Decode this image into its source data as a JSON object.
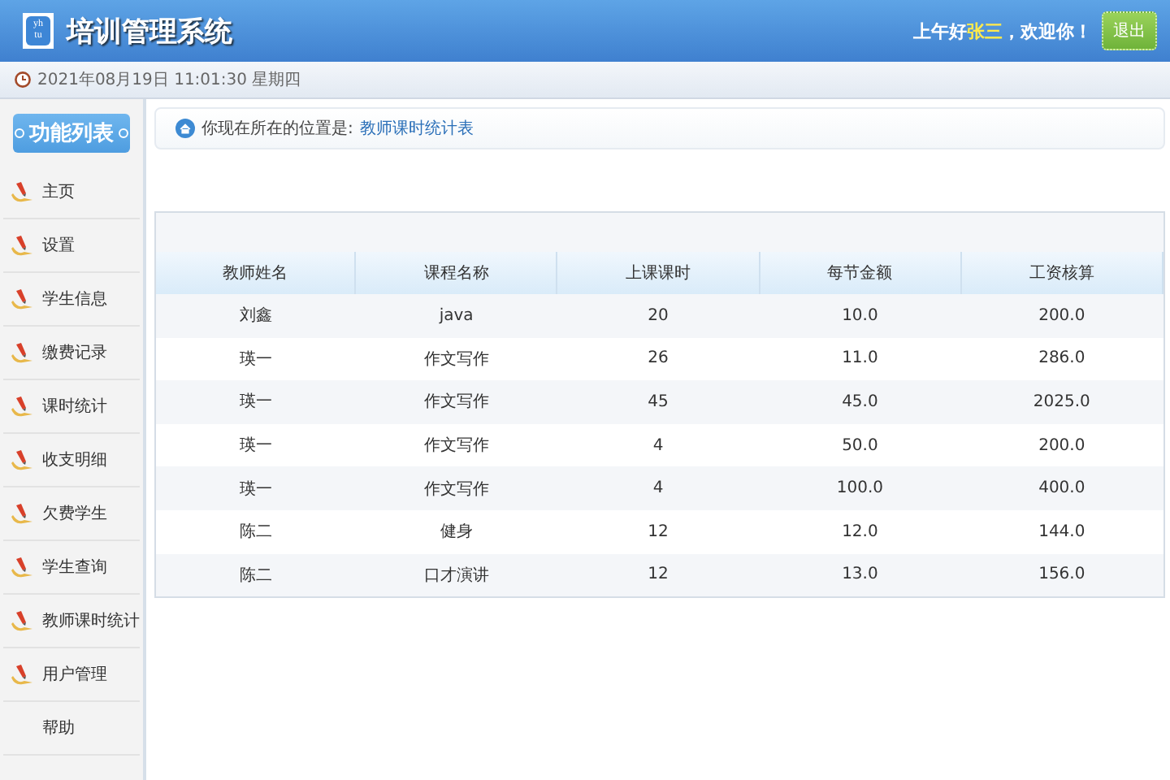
{
  "header": {
    "logo_text": "yh\ntu",
    "title": "培训管理系统",
    "greeting_prefix": "上午好",
    "user_name": "张三",
    "greeting_suffix": "，欢迎你！",
    "logout_button": "退出"
  },
  "date_bar": {
    "datetime": "2021年08月19日 11:01:30 星期四"
  },
  "sidebar": {
    "title": "功能列表",
    "items": [
      {
        "label": "主页",
        "has_icon": true
      },
      {
        "label": "设置",
        "has_icon": true
      },
      {
        "label": "学生信息",
        "has_icon": true
      },
      {
        "label": "缴费记录",
        "has_icon": true
      },
      {
        "label": "课时统计",
        "has_icon": true
      },
      {
        "label": "收支明细",
        "has_icon": true
      },
      {
        "label": "欠费学生",
        "has_icon": true
      },
      {
        "label": "学生查询",
        "has_icon": true
      },
      {
        "label": "教师课时统计",
        "has_icon": true
      },
      {
        "label": "用户管理",
        "has_icon": true
      },
      {
        "label": "帮助",
        "has_icon": false
      }
    ]
  },
  "breadcrumb": {
    "prefix": "你现在所在的位置是:",
    "current": "教师课时统计表"
  },
  "table": {
    "columns": [
      "教师姓名",
      "课程名称",
      "上课课时",
      "每节金额",
      "工资核算"
    ],
    "rows": [
      [
        "刘鑫",
        "java",
        "20",
        "10.0",
        "200.0"
      ],
      [
        "瑛一",
        "作文写作",
        "26",
        "11.0",
        "286.0"
      ],
      [
        "瑛一",
        "作文写作",
        "45",
        "45.0",
        "2025.0"
      ],
      [
        "瑛一",
        "作文写作",
        "4",
        "50.0",
        "200.0"
      ],
      [
        "瑛一",
        "作文写作",
        "4",
        "100.0",
        "400.0"
      ],
      [
        "陈二",
        "健身",
        "12",
        "12.0",
        "144.0"
      ],
      [
        "陈二",
        "口才演讲",
        "12",
        "13.0",
        "156.0"
      ]
    ]
  }
}
